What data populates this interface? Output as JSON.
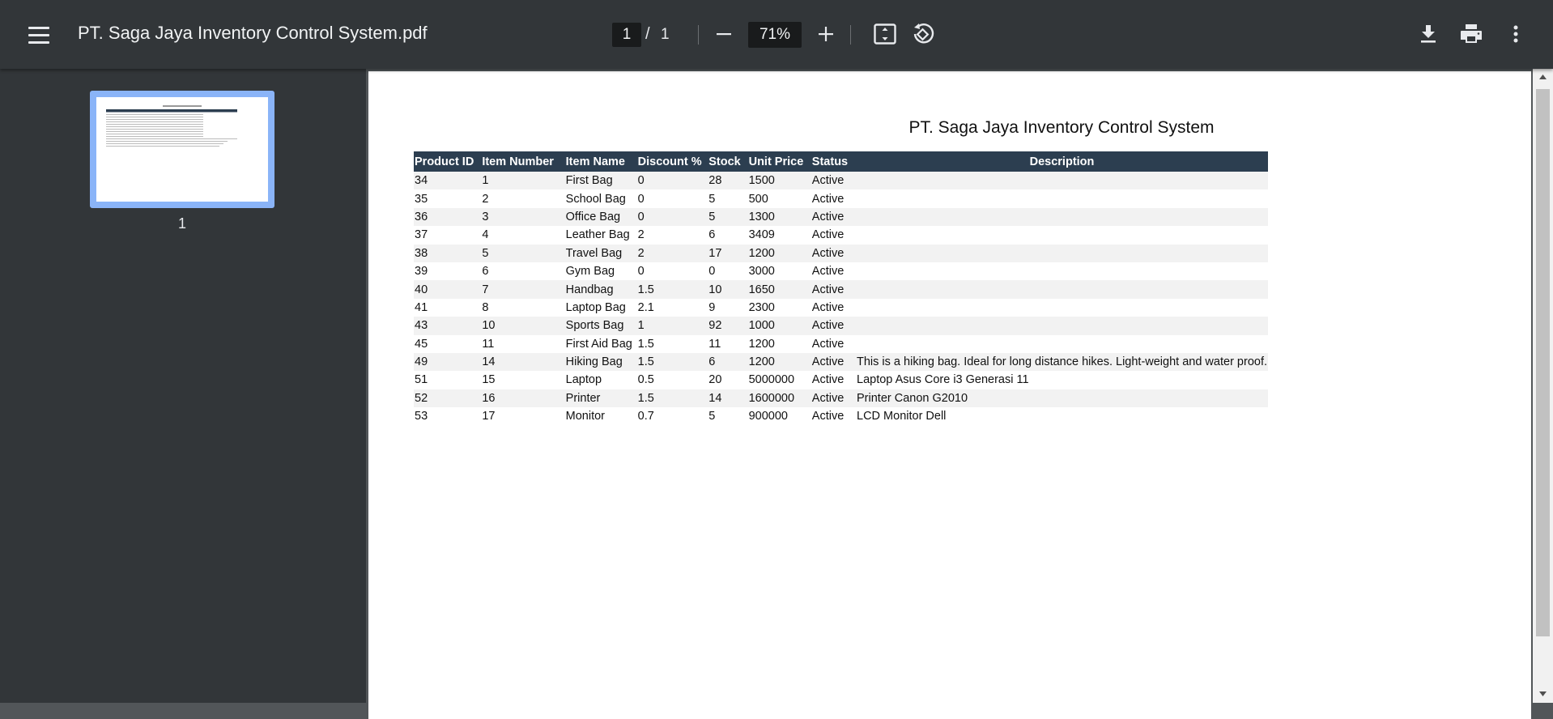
{
  "toolbar": {
    "title": "PT. Saga Jaya Inventory Control System.pdf",
    "page_current": "1",
    "page_separator": "/",
    "page_total": "1",
    "zoom": "71%"
  },
  "sidebar": {
    "thumbnail_label": "1"
  },
  "document": {
    "title": "PT. Saga Jaya Inventory Control System",
    "columns": [
      "Product ID",
      "Item Number",
      "Item Name",
      "Discount %",
      "Stock",
      "Unit Price",
      "Status",
      "Description"
    ],
    "rows": [
      [
        "34",
        "1",
        "First Bag",
        "0",
        "28",
        "1500",
        "Active",
        ""
      ],
      [
        "35",
        "2",
        "School Bag",
        "0",
        "5",
        "500",
        "Active",
        ""
      ],
      [
        "36",
        "3",
        "Office Bag",
        "0",
        "5",
        "1300",
        "Active",
        ""
      ],
      [
        "37",
        "4",
        "Leather Bag",
        "2",
        "6",
        "3409",
        "Active",
        ""
      ],
      [
        "38",
        "5",
        "Travel Bag",
        "2",
        "17",
        "1200",
        "Active",
        ""
      ],
      [
        "39",
        "6",
        "Gym Bag",
        "0",
        "0",
        "3000",
        "Active",
        ""
      ],
      [
        "40",
        "7",
        "Handbag",
        "1.5",
        "10",
        "1650",
        "Active",
        ""
      ],
      [
        "41",
        "8",
        "Laptop Bag",
        "2.1",
        "9",
        "2300",
        "Active",
        ""
      ],
      [
        "43",
        "10",
        "Sports Bag",
        "1",
        "92",
        "1000",
        "Active",
        ""
      ],
      [
        "45",
        "11",
        "First Aid Bag",
        "1.5",
        "11",
        "1200",
        "Active",
        ""
      ],
      [
        "49",
        "14",
        "Hiking Bag",
        "1.5",
        "6",
        "1200",
        "Active",
        "This is a hiking bag. Ideal for long distance hikes. Light-weight and water proof."
      ],
      [
        "51",
        "15",
        "Laptop",
        "0.5",
        "20",
        "5000000",
        "Active",
        "Laptop Asus Core i3 Generasi 11"
      ],
      [
        "52",
        "16",
        "Printer",
        "1.5",
        "14",
        "1600000",
        "Active",
        "Printer Canon G2010"
      ],
      [
        "53",
        "17",
        "Monitor",
        "0.7",
        "5",
        "900000",
        "Active",
        "LCD Monitor Dell"
      ]
    ]
  },
  "icons": {
    "menu": "hamburger-menu-icon",
    "zoom_out": "minus-icon",
    "zoom_in": "plus-icon",
    "fit": "fit-page-icon",
    "rotate": "rotate-icon",
    "download": "download-icon",
    "print": "print-icon",
    "more": "more-vert-icon"
  }
}
